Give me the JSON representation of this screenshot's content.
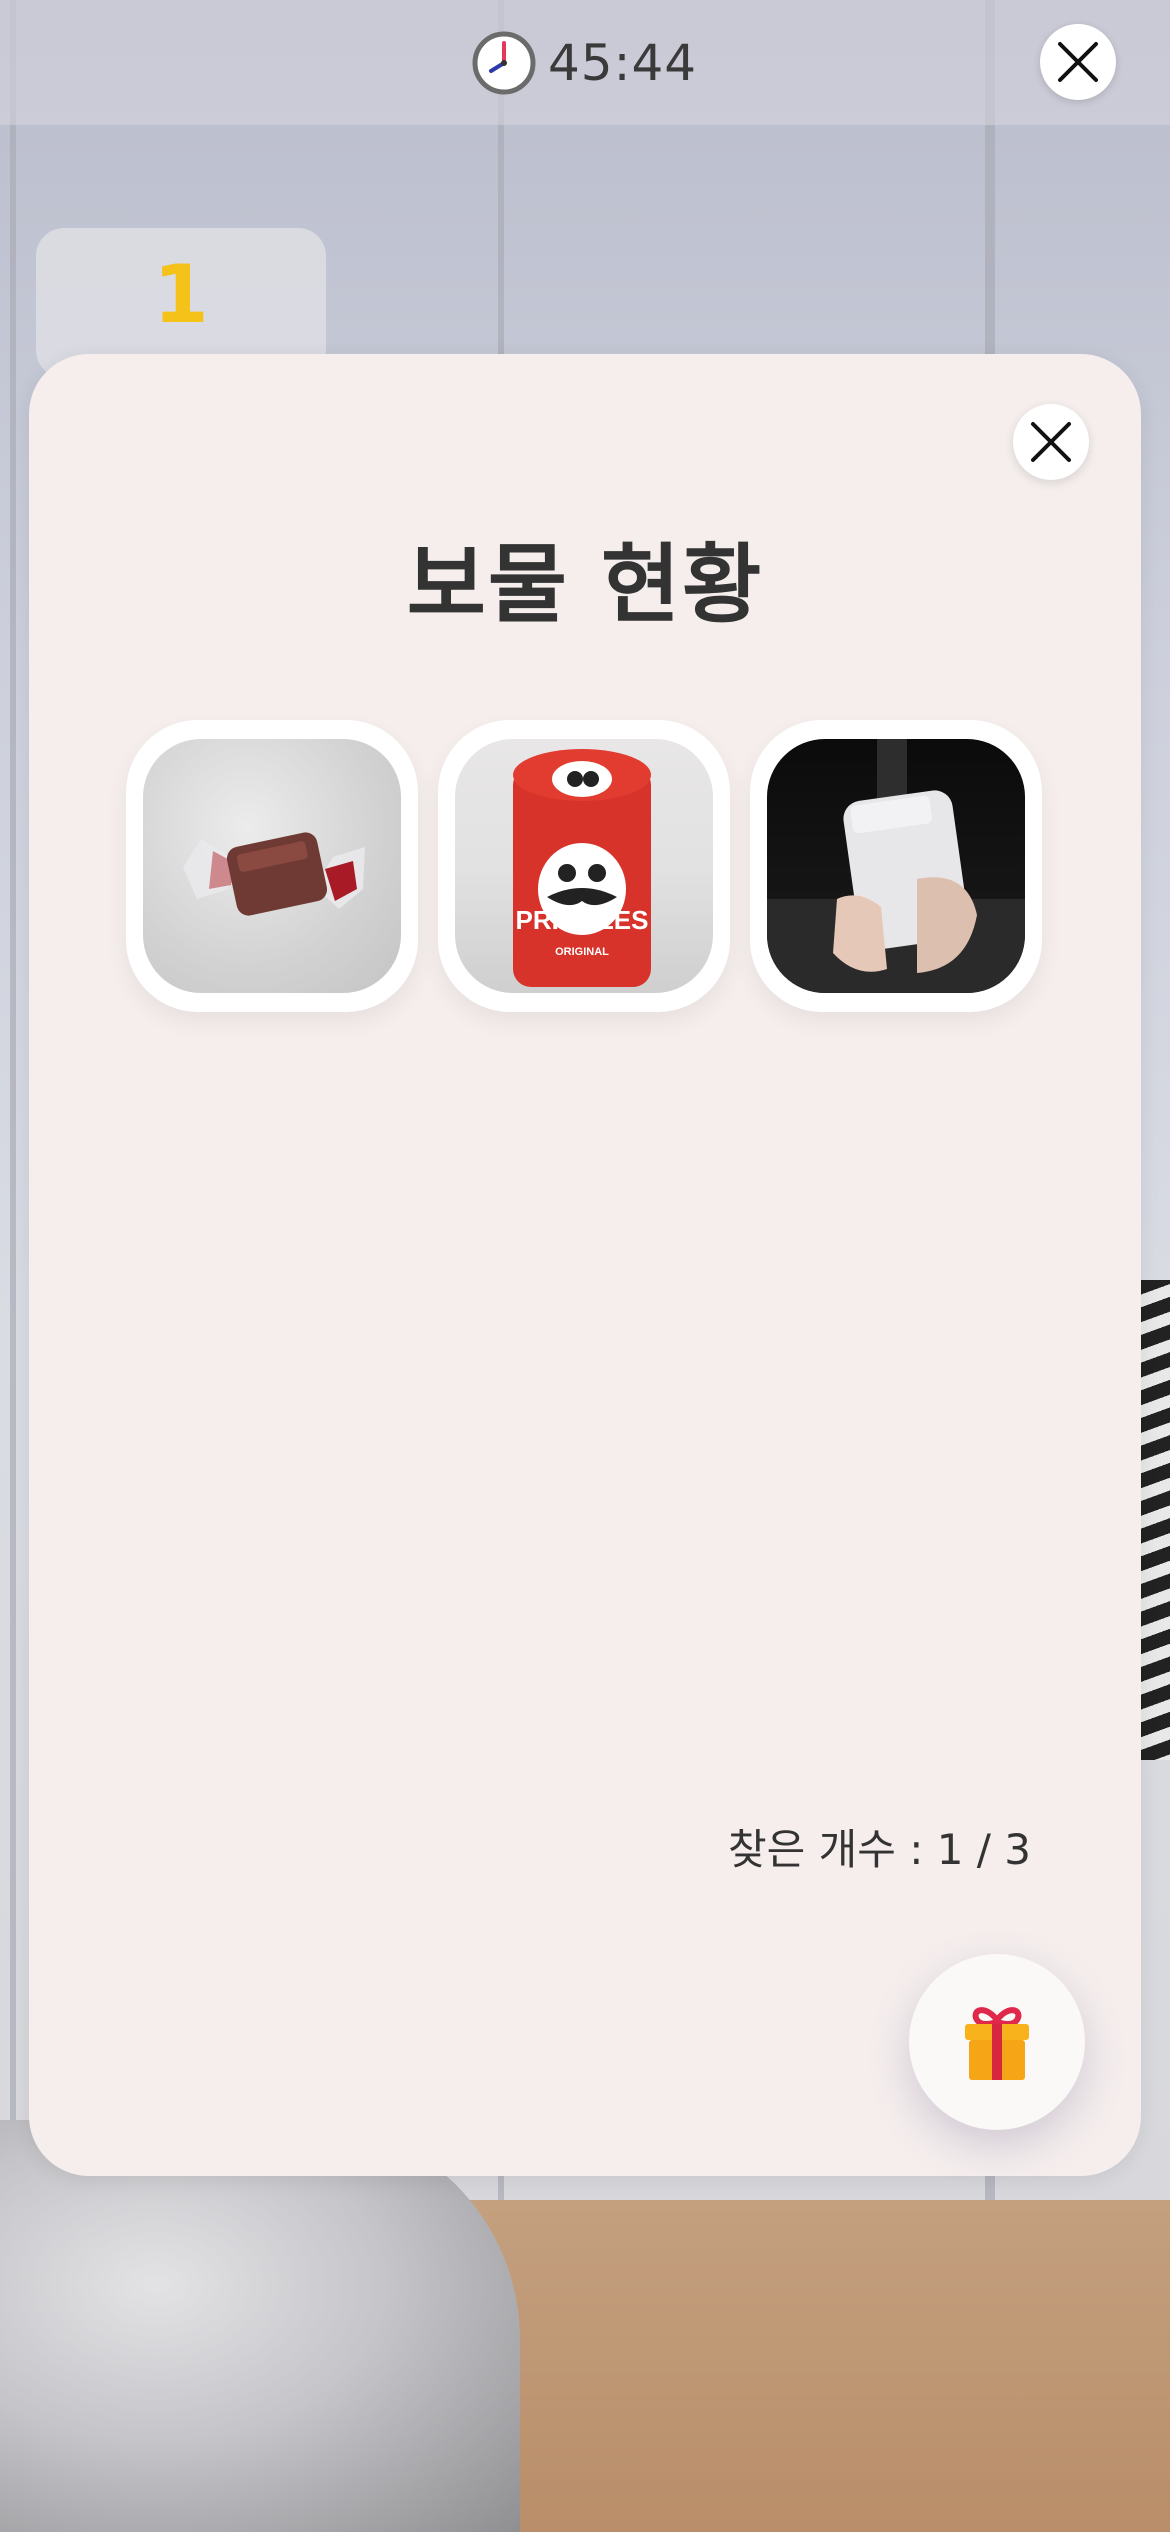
{
  "timer": {
    "value": "45:44",
    "icon": "clock-icon"
  },
  "top_close": {
    "icon": "close-icon"
  },
  "tab": {
    "number": "1"
  },
  "modal": {
    "title": "보물 현황",
    "close_icon": "close-icon",
    "treasures": [
      {
        "name": "candy",
        "icon": "candy-photo"
      },
      {
        "name": "can",
        "icon": "pringles-can-photo",
        "label": "PRINGLES",
        "sublabel": "ORIGINAL"
      },
      {
        "name": "bottle",
        "icon": "bottle-photo"
      }
    ],
    "count_text": "찾은 개수 : 1 / 3",
    "gift_icon": "gift-icon"
  },
  "colors": {
    "accent_yellow": "#f5c21a",
    "can_red": "#d8332a",
    "modal_bg": "#f5eeed"
  }
}
